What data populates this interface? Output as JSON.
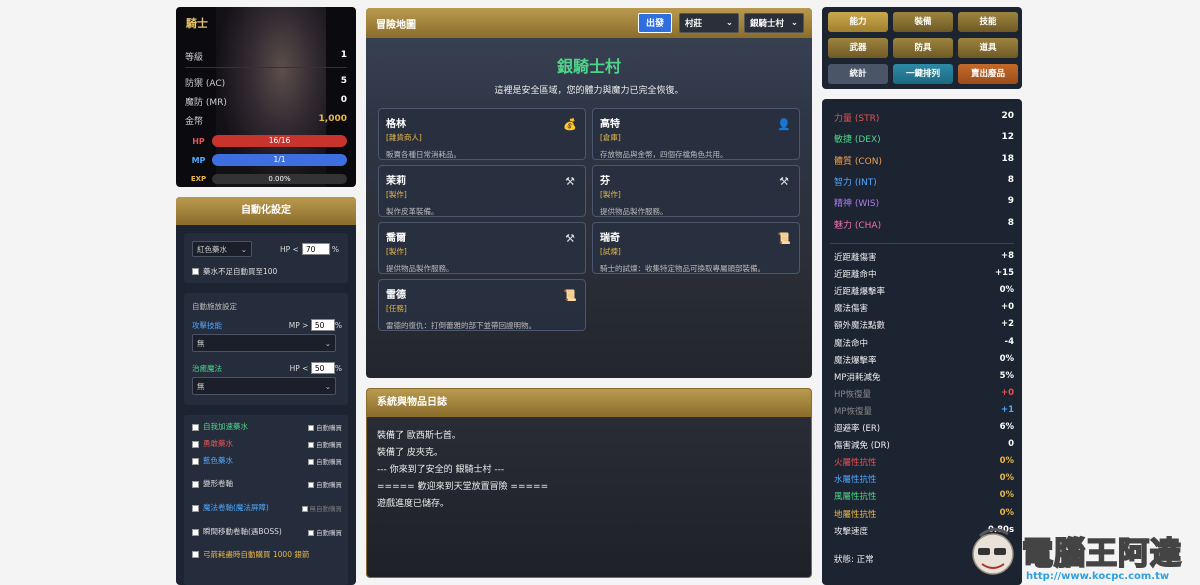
{
  "character": {
    "name": "騎士",
    "stats": [
      {
        "label": "等級",
        "value": "1"
      },
      {
        "label": "防禦 (AC)",
        "value": "5"
      },
      {
        "label": "魔防 (MR)",
        "value": "0"
      },
      {
        "label": "金幣",
        "value": "1,000"
      }
    ],
    "hp": {
      "label": "HP",
      "text": "16/16",
      "fraction": 1.0,
      "color": "#c8332e"
    },
    "mp": {
      "label": "MP",
      "text": "1/1",
      "fraction": 1.0,
      "color": "#3d6fe0"
    },
    "exp": {
      "label": "EXP",
      "text": "0.00%",
      "fraction": 0.0
    }
  },
  "auto": {
    "title": "自動化設定",
    "potion_select": "紅色藥水",
    "hp_label": "HP <",
    "hp_value": "70",
    "pct": "%",
    "buy_label": "藥水不足自動買至100",
    "cast_title": "自動施放設定",
    "attack_label": "攻擊技能",
    "attack_mp_label": "MP >",
    "attack_mp_value": "50",
    "attack_select": "無",
    "heal_label": "治癒魔法",
    "heal_hp_label": "HP <",
    "heal_hp_value": "50",
    "heal_select": "無",
    "items": [
      {
        "label": "自我加速藥水",
        "color": "#4fd48a",
        "auto": "自動購買",
        "auto_color": "#ccc"
      },
      {
        "label": "勇敢藥水",
        "color": "#e05555",
        "auto": "自動購買",
        "auto_color": "#ccc"
      },
      {
        "label": "藍色藥水",
        "color": "#4fa8ff",
        "auto": "自動購買",
        "auto_color": "#ccc"
      },
      {
        "label": "變形卷軸",
        "color": "#ddd",
        "auto": "自動購買",
        "auto_color": "#ccc"
      },
      {
        "label": "魔法卷軸(魔法屏障)",
        "color": "#4fa8ff",
        "auto": "無自動購買",
        "auto_color": "#777"
      },
      {
        "label": "瞬間移動卷軸(遇BOSS)",
        "color": "#ddd",
        "auto": "自動購買",
        "auto_color": "#ccc"
      }
    ],
    "arrow_label": "弓箭耗盡時自動購買 1000 銀箭"
  },
  "map": {
    "title": "冒險地圖",
    "go": "出發",
    "region": "村莊",
    "town": "銀騎士村",
    "town_name": "銀騎士村",
    "desc": "這裡是安全區域，您的體力與魔力已完全恢復。",
    "npcs": [
      {
        "name": "格林",
        "role": "[雜貨商人]",
        "desc": "販賣各種日常消耗品。",
        "icon": "money-bag-icon",
        "glyph": "💰"
      },
      {
        "name": "高特",
        "role": "[倉庫]",
        "desc": "存放物品與金幣，四個存檔角色共用。",
        "icon": "person-icon",
        "glyph": "👤"
      },
      {
        "name": "茉莉",
        "role": "[製作]",
        "desc": "製作皮革裝備。",
        "icon": "crossed-hammers-icon",
        "glyph": "⚒"
      },
      {
        "name": "芬",
        "role": "[製作]",
        "desc": "提供物品製作服務。",
        "icon": "crossed-hammers-icon",
        "glyph": "⚒"
      },
      {
        "name": "喬爾",
        "role": "[製作]",
        "desc": "提供物品製作服務。",
        "icon": "crossed-hammers-icon",
        "glyph": "⚒"
      },
      {
        "name": "瑞奇",
        "role": "[試煉]",
        "desc": "騎士的試煉：收集特定物品可換取專屬頭部裝備。",
        "icon": "scroll-icon",
        "glyph": "📜"
      },
      {
        "name": "雷德",
        "role": "[任務]",
        "desc": "雷德的復仇：打倒蕾雅的部下並帶回證明物。",
        "icon": "scroll-icon",
        "glyph": "📜"
      }
    ]
  },
  "log": {
    "title": "系統與物品日誌",
    "lines": [
      "裝備了 歐西斯七首。",
      "裝備了 皮夾克。",
      "--- 你來到了安全的 銀騎士村 ---",
      "===== 歡迎來到天堂放置冒險 =====",
      "遊戲進度已儲存。"
    ]
  },
  "tabs": [
    {
      "label": "能力",
      "style": "act"
    },
    {
      "label": "裝備",
      "style": "g"
    },
    {
      "label": "技能",
      "style": "g"
    },
    {
      "label": "武器",
      "style": "g"
    },
    {
      "label": "防具",
      "style": "g"
    },
    {
      "label": "道具",
      "style": "g"
    },
    {
      "label": "統計",
      "style": "gray"
    },
    {
      "label": "一鍵排列",
      "style": "teal"
    },
    {
      "label": "賣出廢品",
      "style": "or"
    }
  ],
  "attributes": [
    {
      "label": "力量 (STR)",
      "value": "20",
      "color": "#e05555"
    },
    {
      "label": "敏捷 (DEX)",
      "value": "12",
      "color": "#4fd48a"
    },
    {
      "label": "體質 (CON)",
      "value": "18",
      "color": "#f0a050"
    },
    {
      "label": "智力 (INT)",
      "value": "8",
      "color": "#4fa8ff"
    },
    {
      "label": "精神 (WIS)",
      "value": "9",
      "color": "#b07cf0"
    },
    {
      "label": "魅力 (CHA)",
      "value": "8",
      "color": "#f070b0"
    }
  ],
  "secondary": [
    {
      "label": "近距離傷害",
      "value": "+8",
      "lc": "#eee",
      "vc": "#fff"
    },
    {
      "label": "近距離命中",
      "value": "+15",
      "lc": "#eee",
      "vc": "#fff"
    },
    {
      "label": "近距離爆擊率",
      "value": "0%",
      "lc": "#eee",
      "vc": "#fff"
    },
    {
      "label": "魔法傷害",
      "value": "+0",
      "lc": "#eee",
      "vc": "#fff"
    },
    {
      "label": "額外魔法點數",
      "value": "+2",
      "lc": "#eee",
      "vc": "#fff"
    },
    {
      "label": "魔法命中",
      "value": "-4",
      "lc": "#eee",
      "vc": "#fff"
    },
    {
      "label": "魔法爆擊率",
      "value": "0%",
      "lc": "#eee",
      "vc": "#fff"
    },
    {
      "label": "MP消耗減免",
      "value": "5%",
      "lc": "#eee",
      "vc": "#fff"
    },
    {
      "label": "HP恢復量",
      "value": "+0",
      "lc": "#888",
      "vc": "#e05555"
    },
    {
      "label": "MP恢復量",
      "value": "+1",
      "lc": "#888",
      "vc": "#4fa8ff"
    },
    {
      "label": "迴避率 (ER)",
      "value": "6%",
      "lc": "#eee",
      "vc": "#fff"
    },
    {
      "label": "傷害減免 (DR)",
      "value": "0",
      "lc": "#eee",
      "vc": "#fff"
    },
    {
      "label": "火屬性抗性",
      "value": "0%",
      "lc": "#e05555",
      "vc": "#e8b84a"
    },
    {
      "label": "水屬性抗性",
      "value": "0%",
      "lc": "#4fa8ff",
      "vc": "#e8b84a"
    },
    {
      "label": "風屬性抗性",
      "value": "0%",
      "lc": "#4fd48a",
      "vc": "#e8b84a"
    },
    {
      "label": "地屬性抗性",
      "value": "0%",
      "lc": "#e8b84a",
      "vc": "#e8b84a"
    },
    {
      "label": "攻擊速度",
      "value": "0.80s",
      "lc": "#eee",
      "vc": "#fff"
    }
  ],
  "status": "狀態: 正常",
  "watermark": {
    "title": "電腦王阿達",
    "url": "http://www.kocpc.com.tw"
  }
}
